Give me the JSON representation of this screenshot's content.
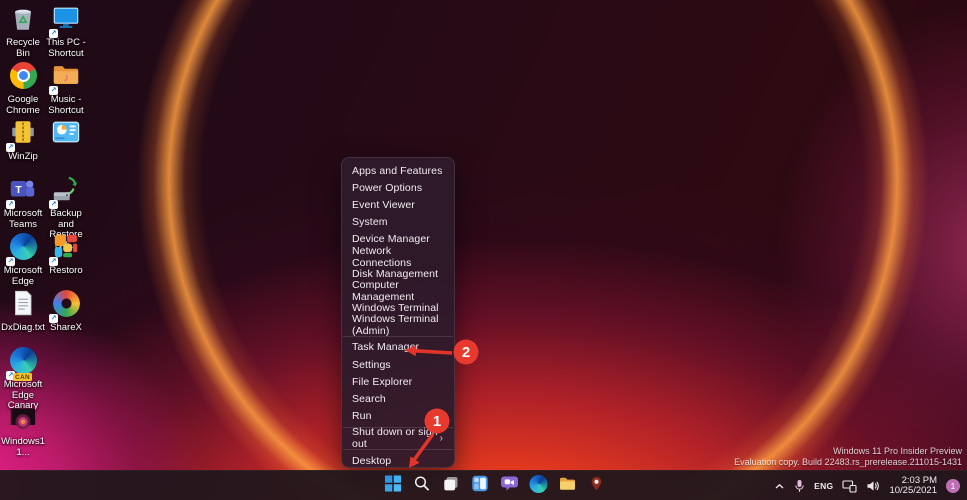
{
  "theme": {
    "accent-red": "#e33429",
    "badge-purple": "#bd6fb5",
    "start-blue": "#3aa3ee",
    "taskbar-bg": "rgba(34,23,28,0.96)",
    "menu-bg": "rgba(46,27,42,0.94)"
  },
  "desktop": {
    "columns": [
      {
        "items": [
          {
            "label": "Recycle Bin",
            "icon": "recycle-bin",
            "shortcut": false
          },
          {
            "label": "Google Chrome",
            "icon": "chrome",
            "shortcut": false
          },
          {
            "label": "WinZip",
            "icon": "winzip",
            "shortcut": true
          },
          {
            "label": "Microsoft Teams",
            "icon": "teams",
            "shortcut": true
          },
          {
            "label": "Microsoft Edge",
            "icon": "edge",
            "shortcut": true
          },
          {
            "label": "DxDiag.txt",
            "icon": "text-file",
            "shortcut": false
          },
          {
            "label": "Microsoft Edge Canary",
            "icon": "edge-canary",
            "shortcut": true,
            "badge": "CAN"
          },
          {
            "label": "Windows11...",
            "icon": "image-thumbnail",
            "shortcut": false
          }
        ]
      },
      {
        "items": [
          {
            "label": "This PC - Shortcut",
            "icon": "monitor",
            "shortcut": true
          },
          {
            "label": "Music - Shortcut",
            "icon": "music-folder",
            "shortcut": true
          },
          {
            "label": "",
            "icon": "control-panel",
            "shortcut": false
          },
          {
            "label": "Backup and Restore (Wi...",
            "icon": "backup-restore",
            "shortcut": true
          },
          {
            "label": "Restoro",
            "icon": "restoro",
            "shortcut": true
          },
          {
            "label": "ShareX",
            "icon": "sharex",
            "shortcut": true
          }
        ]
      }
    ]
  },
  "menu": {
    "groups": [
      {
        "items": [
          {
            "label": "Apps and Features"
          },
          {
            "label": "Power Options"
          },
          {
            "label": "Event Viewer"
          },
          {
            "label": "System"
          },
          {
            "label": "Device Manager"
          },
          {
            "label": "Network Connections"
          },
          {
            "label": "Disk Management"
          },
          {
            "label": "Computer Management"
          },
          {
            "label": "Windows Terminal"
          },
          {
            "label": "Windows Terminal (Admin)"
          }
        ]
      },
      {
        "items": [
          {
            "label": "Task Manager"
          },
          {
            "label": "Settings"
          },
          {
            "label": "File Explorer"
          },
          {
            "label": "Search"
          },
          {
            "label": "Run"
          }
        ]
      },
      {
        "items": [
          {
            "label": "Shut down or sign out",
            "submenu": true,
            "submenu_arrow": "›"
          }
        ]
      },
      {
        "items": [
          {
            "label": "Desktop"
          }
        ]
      }
    ]
  },
  "taskbar": {
    "buttons": [
      {
        "name": "start",
        "icon": "start"
      },
      {
        "name": "search",
        "icon": "search"
      },
      {
        "name": "task-view",
        "icon": "task-view"
      },
      {
        "name": "widgets",
        "icon": "widgets"
      },
      {
        "name": "chat",
        "icon": "chat"
      },
      {
        "name": "edge",
        "icon": "edge-taskbar"
      },
      {
        "name": "file-explorer",
        "icon": "folder"
      },
      {
        "name": "pinned-app",
        "icon": "map-pin"
      }
    ],
    "tray": {
      "language": "ENG",
      "time": "2:03 PM",
      "date": "10/25/2021",
      "notification_count": "1"
    }
  },
  "watermark": {
    "line1": "Windows 11 Pro Insider Preview",
    "line2": "Evaluation copy. Build 22483.rs_prerelease.211015-1431"
  },
  "annotations": {
    "step1_label": "1",
    "step2_label": "2"
  }
}
